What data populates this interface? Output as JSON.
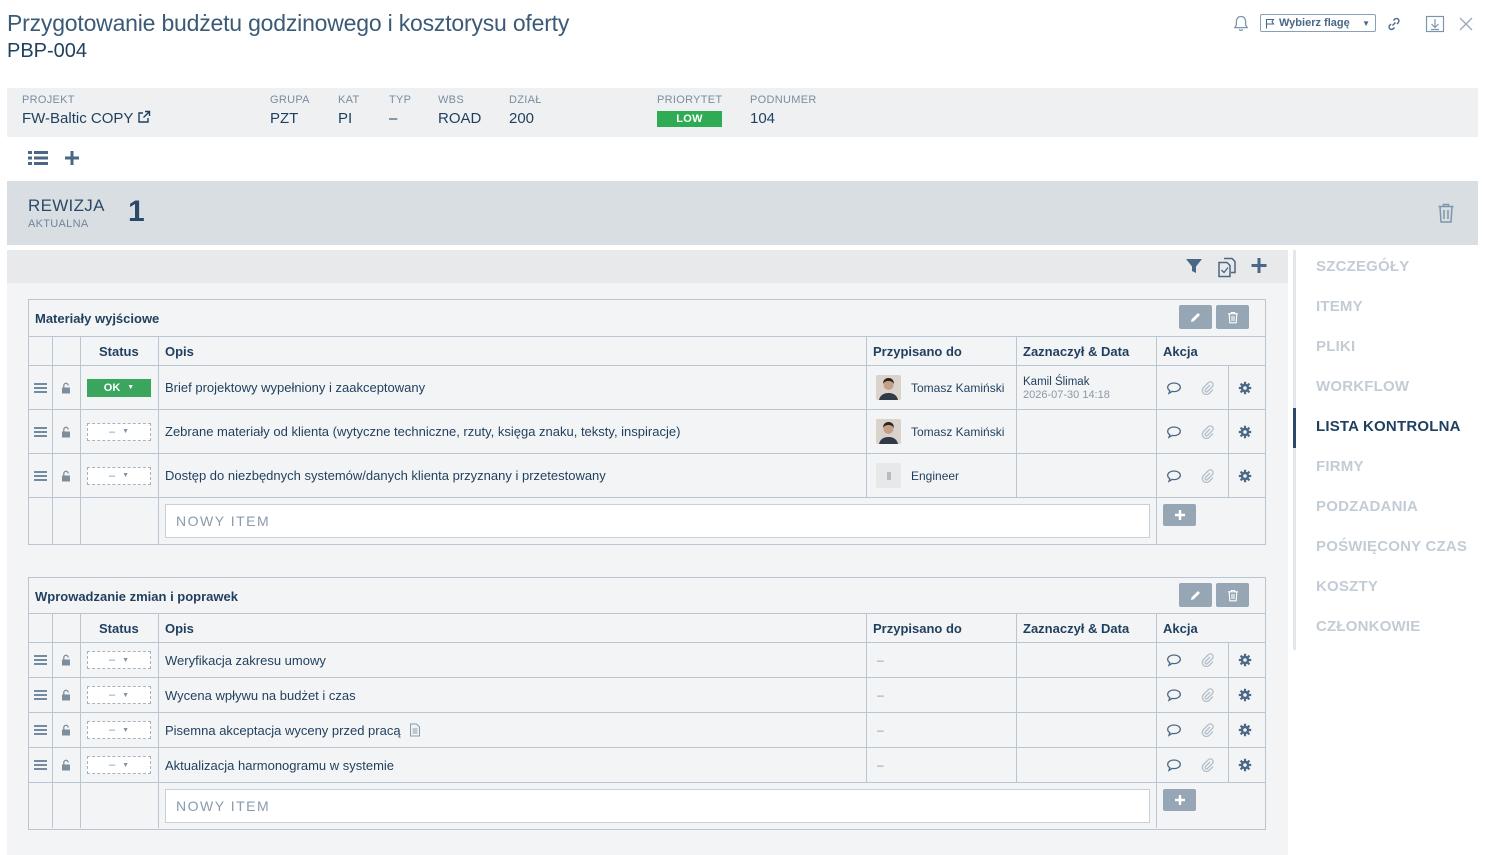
{
  "header": {
    "title": "Przygotowanie budżetu godzinowego i kosztorysu oferty",
    "code": "PBP-004",
    "flag_select": "Wybierz flagę"
  },
  "info": {
    "projekt_label": "PROJEKT",
    "projekt": "FW-Baltic COPY",
    "grupa_label": "GRUPA",
    "grupa": "PZT",
    "kat_label": "KAT",
    "kat": "PI",
    "typ_label": "TYP",
    "typ": "–",
    "wbs_label": "WBS",
    "wbs": "ROAD",
    "dzial_label": "DZIAŁ",
    "dzial": "200",
    "priorytet_label": "PRIORYTET",
    "priorytet": "LOW",
    "podnumer_label": "PODNUMER",
    "podnumer": "104",
    "priority_color": "#2fab54"
  },
  "revision": {
    "label": "REWIZJA",
    "sub": "AKTUALNA",
    "number": "1"
  },
  "columns": {
    "status": "Status",
    "opis": "Opis",
    "assigned": "Przypisano do",
    "marked": "Zaznaczył & Data",
    "action": "Akcja"
  },
  "new_item_placeholder": "NOWY ITEM",
  "sections": [
    {
      "title": "Materiały wyjściowe",
      "rows": [
        {
          "status": "OK",
          "opis": "Brief projektowy wypełniony i zaakceptowany",
          "assignee": "Tomasz Kamiński",
          "marked_by": "Kamil Ślimak",
          "marked_date": "2026-07-30 14:18"
        },
        {
          "status": "–",
          "opis": "Zebrane materiały od klienta (wytyczne techniczne, rzuty, księga znaku, teksty, inspiracje)",
          "assignee": "Tomasz Kamiński"
        },
        {
          "status": "–",
          "opis": "Dostęp do niezbędnych systemów/danych klienta przyznany i przetestowany",
          "assignee": "Engineer"
        }
      ]
    },
    {
      "title": "Wprowadzanie zmian i poprawek",
      "rows": [
        {
          "status": "–",
          "opis": "Weryfikacja zakresu umowy",
          "assignee": "–"
        },
        {
          "status": "–",
          "opis": "Wycena wpływu na budżet i czas",
          "assignee": "–"
        },
        {
          "status": "–",
          "opis": "Pisemna akceptacja wyceny przed pracą",
          "assignee": "–"
        },
        {
          "status": "–",
          "opis": "Aktualizacja harmonogramu w systemie",
          "assignee": "–"
        }
      ]
    }
  ],
  "nav": [
    "SZCZEGÓŁY",
    "ITEMY",
    "PLIKI",
    "WORKFLOW",
    "LISTA KONTROLNA",
    "FIRMY",
    "PODZADANIA",
    "POŚWIĘCONY CZAS",
    "KOSZTY",
    "CZŁONKOWIE"
  ],
  "nav_active": "LISTA KONTROLNA",
  "icons": {
    "bell": "bell-icon",
    "flag": "flag-icon",
    "link": "link-icon",
    "download": "download-icon",
    "close": "close-icon",
    "external": "external-link-icon",
    "list": "list-icon",
    "plus": "plus-icon",
    "trash": "trash-icon",
    "filter": "filter-icon",
    "copy": "copy-icon",
    "pencil": "pencil-icon",
    "drag": "drag-handle-icon",
    "lock": "lock-icon",
    "comment": "comment-icon",
    "attachment": "paperclip-icon",
    "settings": "gear-icon",
    "document": "document-icon"
  }
}
